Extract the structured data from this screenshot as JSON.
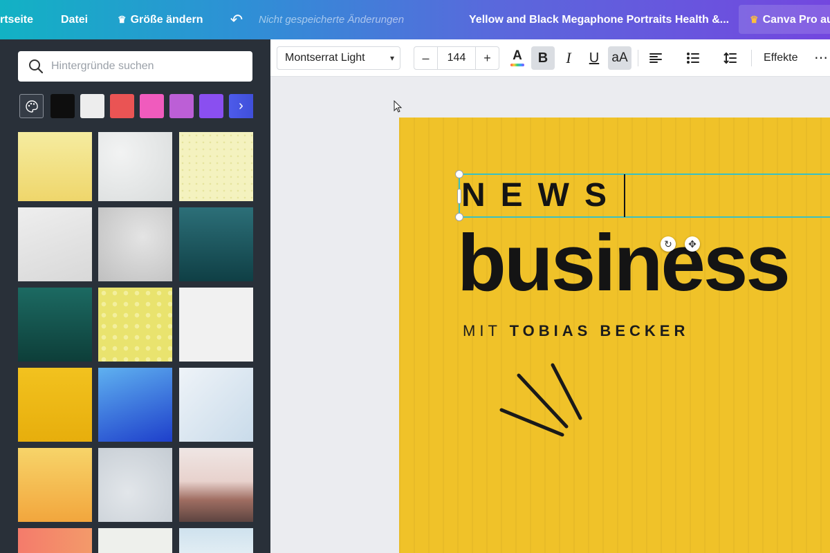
{
  "topbar": {
    "home_label": "rtseite",
    "file_label": "Datei",
    "resize_label": "Größe ändern",
    "unsaved_text": "Nicht gespeicherte Änderungen",
    "design_title": "Yellow and Black Megaphone Portraits Health &...",
    "pro_label": "Canva Pro au"
  },
  "sidepanel": {
    "search_placeholder": "Hintergründe suchen",
    "swatches": [
      "#0e0e0e",
      "#ededed",
      "#ea5454",
      "#f05bbd",
      "#bc5fd6",
      "#8a4ff0"
    ]
  },
  "toolbar": {
    "font_name": "Montserrat Light",
    "font_size": "144",
    "minus_label": "–",
    "plus_label": "+",
    "color_label": "A",
    "bold_label": "B",
    "italic_label": "I",
    "underline_label": "U",
    "case_label": "aA",
    "effects_label": "Effekte"
  },
  "canvas": {
    "headline": "NEWS",
    "main_word": "business",
    "subtitle_prefix": "MIT",
    "subtitle_name": "TOBIAS BECKER",
    "page_color": "#f0c229"
  }
}
